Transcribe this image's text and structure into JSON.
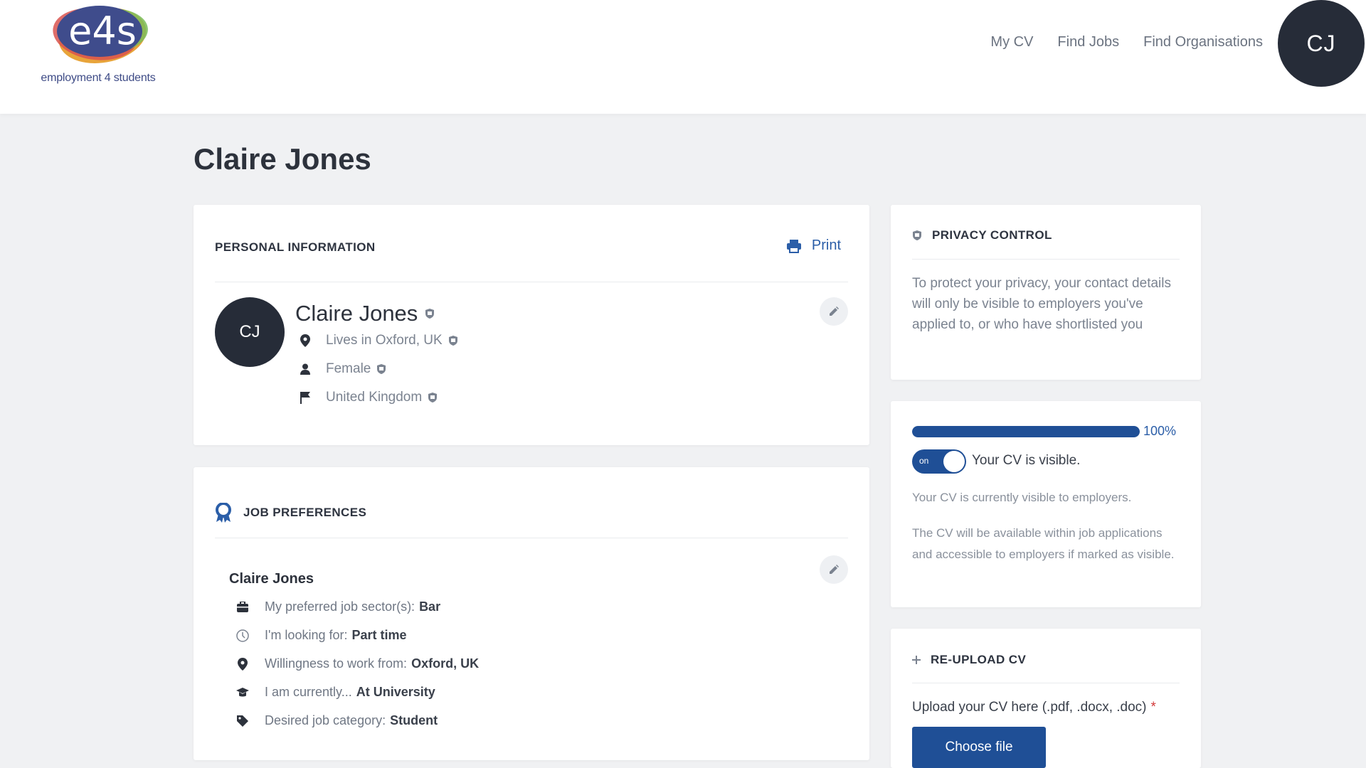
{
  "brand": {
    "logo_text": "e4s",
    "tagline": "employment 4 students"
  },
  "nav": {
    "items": [
      "My CV",
      "Find Jobs",
      "Find Organisations"
    ],
    "avatar_initials": "CJ"
  },
  "page": {
    "title": "Claire Jones"
  },
  "personal_info": {
    "heading": "PERSONAL INFORMATION",
    "print_label": "Print",
    "avatar_initials": "CJ",
    "name": "Claire Jones",
    "location": "Lives in Oxford, UK",
    "gender": "Female",
    "country": "United Kingdom"
  },
  "job_preferences": {
    "heading": "JOB PREFERENCES",
    "name": "Claire Jones",
    "rows": [
      {
        "label": "My preferred job sector(s):",
        "value": "Bar",
        "icon": "briefcase-icon"
      },
      {
        "label": "I'm looking for:",
        "value": "Part time",
        "icon": "clock-icon"
      },
      {
        "label": "Willingness to work from:",
        "value": "Oxford, UK",
        "icon": "map-pin-icon"
      },
      {
        "label": "I am currently...",
        "value": "At University",
        "icon": "graduation-cap-icon"
      },
      {
        "label": "Desired job category:",
        "value": "Student",
        "icon": "tag-icon"
      }
    ]
  },
  "privacy": {
    "heading": "PRIVACY CONTROL",
    "text": "To protect your privacy, your contact details will only be visible to employers you've applied to, or who have shortlisted you"
  },
  "visibility": {
    "progress": 100,
    "progress_label": "100%",
    "toggle_label": "on",
    "toggle_on": true,
    "title": "Your CV is visible.",
    "status_text": "Your CV is currently visible to employers.",
    "info_text": "The CV will be available within job applications and accessible to employers if marked as visible."
  },
  "upload": {
    "heading": "RE-UPLOAD CV",
    "label": "Upload your CV here (.pdf, .docx, .doc)",
    "required_mark": "*",
    "button_label": "Choose file"
  },
  "colors": {
    "primary": "#1f4f96",
    "link": "#2b5ea8",
    "avatar_bg": "#262c38",
    "page_bg": "#f0f1f3",
    "required": "#d33a3a"
  }
}
